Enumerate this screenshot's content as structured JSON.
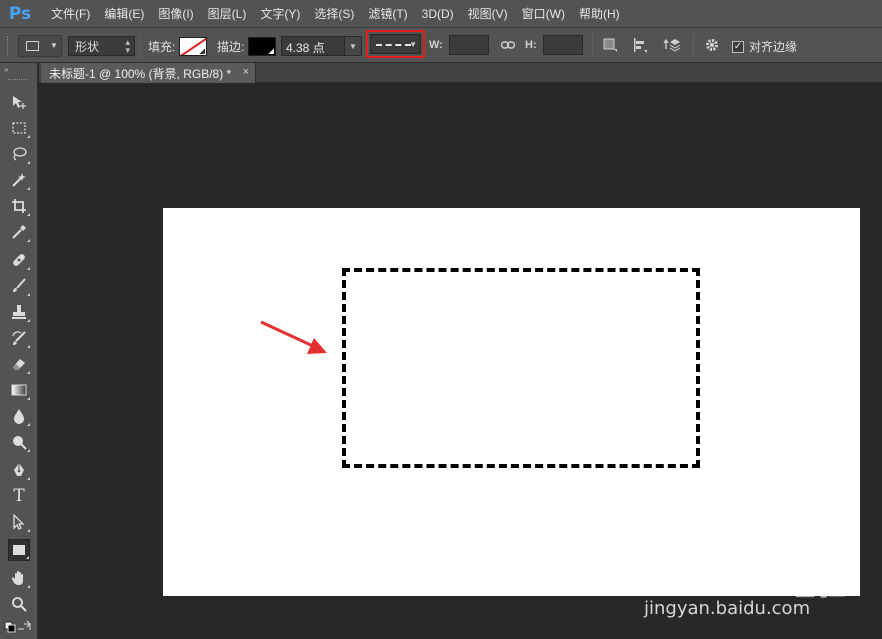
{
  "app": {
    "logo": "Ps",
    "menu": [
      "文件(F)",
      "编辑(E)",
      "图像(I)",
      "图层(L)",
      "文字(Y)",
      "选择(S)",
      "滤镜(T)",
      "3D(D)",
      "视图(V)",
      "窗口(W)",
      "帮助(H)"
    ]
  },
  "options": {
    "mode": "形状",
    "fill_label": "填充:",
    "stroke_label": "描边:",
    "stroke_width": "4.38 点",
    "w_label": "W:",
    "h_label": "H:",
    "align_edges_label": "对齐边缘",
    "align_edges_checked": true,
    "fill_color": "#ffffff",
    "fill_none_indicator": "#e02020",
    "stroke_color": "#000000",
    "highlight_color": "#e02020"
  },
  "document": {
    "tab_title": "未标题-1 @ 100% (背景, RGB/8) *",
    "close_glyph": "×"
  },
  "tools": [
    "move-icon",
    "marquee-icon",
    "lasso-icon",
    "magic-wand-icon",
    "crop-icon",
    "eyedropper-icon",
    "healing-brush-icon",
    "brush-icon",
    "clone-stamp-icon",
    "history-brush-icon",
    "eraser-icon",
    "gradient-icon",
    "blur-icon",
    "dodge-icon",
    "pen-icon",
    "type-icon",
    "path-selection-icon",
    "rectangle-icon",
    "hand-icon",
    "zoom-icon"
  ],
  "toolbar": {
    "collapse_glyph": "»",
    "type_tool_label": "T"
  },
  "canvas": {
    "background": "#ffffff",
    "shape_stroke": "#000000",
    "arrow_color": "#e53030"
  },
  "watermark": {
    "logo": "Baidu经验",
    "url": "jingyan.baidu.com"
  }
}
